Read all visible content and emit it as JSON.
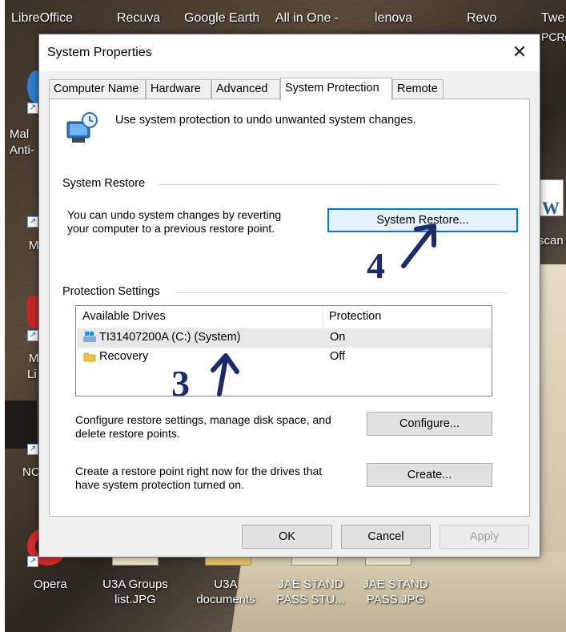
{
  "desktop": {
    "taskbar_labels": [
      "LibreOffice",
      "Recuva",
      "Google Earth",
      "All in One -",
      "lenova",
      "Revo",
      "Twe",
      "PCRe"
    ],
    "side_labels": [
      "Mal",
      "Anti-",
      "M",
      "M",
      "Li",
      "NC"
    ],
    "right_label": "scan",
    "bottom_labels": [
      {
        "line1": "Opera",
        "line2": ""
      },
      {
        "line1": "U3A Groups",
        "line2": "list.JPG"
      },
      {
        "line1": "U3A",
        "line2": "documents"
      },
      {
        "line1": "JAE STAND",
        "line2": "PASS STU..."
      },
      {
        "line1": "JAE STAND",
        "line2": "PASS.JPG"
      }
    ]
  },
  "dialog": {
    "title": "System Properties",
    "close_glyph": "✕",
    "tabs": [
      {
        "label": "Computer Name",
        "active": false
      },
      {
        "label": "Hardware",
        "active": false
      },
      {
        "label": "Advanced",
        "active": false
      },
      {
        "label": "System Protection",
        "active": true
      },
      {
        "label": "Remote",
        "active": false
      }
    ],
    "intro": "Use system protection to undo unwanted system changes.",
    "restore": {
      "header": "System Restore",
      "line1": "You can undo system changes by reverting",
      "line2": "your computer to a previous restore point.",
      "button": "System Restore..."
    },
    "protection": {
      "header": "Protection Settings",
      "col_drives": "Available Drives",
      "col_protection": "Protection",
      "drives": [
        {
          "name": "TI31407200A (C:) (System)",
          "protection": "On",
          "icon": "windows-drive-icon",
          "selected": true
        },
        {
          "name": "Recovery",
          "protection": "Off",
          "icon": "folder-icon",
          "selected": false
        }
      ],
      "configure_text_1": "Configure restore settings, manage disk space, and",
      "configure_text_2": "delete restore points.",
      "configure_button": "Configure...",
      "create_text_1": "Create a restore point right now for the drives that",
      "create_text_2": "have system protection turned on.",
      "create_button": "Create..."
    },
    "footer": {
      "ok": "OK",
      "cancel": "Cancel",
      "apply": "Apply"
    }
  },
  "annotations": {
    "step3": "3",
    "step4": "4"
  },
  "colors": {
    "focus_border": "#0078d7",
    "annotation": "#1c2a6e"
  }
}
